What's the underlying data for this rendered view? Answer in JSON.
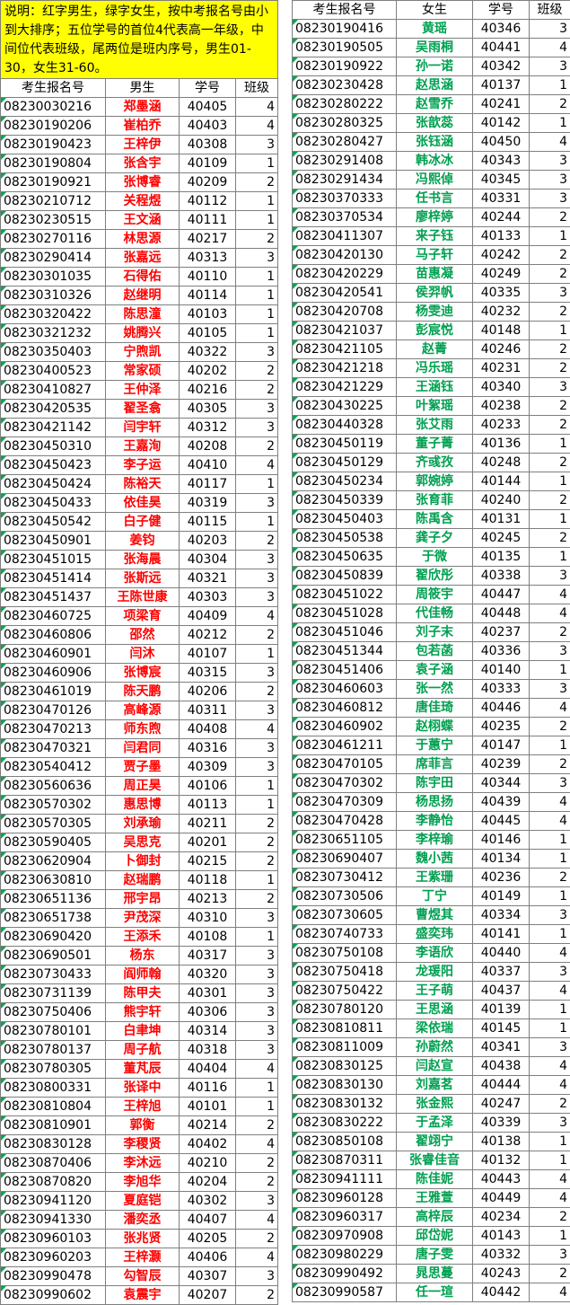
{
  "note": "说明：红字男生，绿字女生，按中考报名号由小到大排序；五位学号的首位4代表高一年级，中间位代表班级，尾两位是班内序号，男生01-30，女生31-60。",
  "colors": {
    "male": "#ff0000",
    "female": "#00a050",
    "note_bg": "#ffff00"
  },
  "male_table": {
    "headers": [
      "考生报名号",
      "男生",
      "学号",
      "班级"
    ],
    "rows": [
      [
        "08230030216",
        "郑墨涵",
        "40405",
        "4"
      ],
      [
        "08230190206",
        "崔柏乔",
        "40403",
        "4"
      ],
      [
        "08230190423",
        "王梓伊",
        "40308",
        "3"
      ],
      [
        "08230190804",
        "张含宇",
        "40109",
        "1"
      ],
      [
        "08230190921",
        "张博睿",
        "40209",
        "2"
      ],
      [
        "08230210712",
        "关程煜",
        "40112",
        "1"
      ],
      [
        "08230230515",
        "王文涵",
        "40111",
        "1"
      ],
      [
        "08230270116",
        "林思源",
        "40217",
        "2"
      ],
      [
        "08230290414",
        "张嘉远",
        "40313",
        "3"
      ],
      [
        "08230301035",
        "石得佑",
        "40110",
        "1"
      ],
      [
        "08230310326",
        "赵继明",
        "40114",
        "1"
      ],
      [
        "08230320422",
        "陈思潼",
        "40103",
        "1"
      ],
      [
        "08230321232",
        "姚腾兴",
        "40105",
        "1"
      ],
      [
        "08230350403",
        "宁煦凯",
        "40322",
        "3"
      ],
      [
        "08230400523",
        "常家硕",
        "40202",
        "2"
      ],
      [
        "08230410827",
        "王仲泽",
        "40216",
        "2"
      ],
      [
        "08230420535",
        "翟圣翕",
        "40305",
        "3"
      ],
      [
        "08230421142",
        "闫宇轩",
        "40312",
        "3"
      ],
      [
        "08230450310",
        "王嘉洵",
        "40208",
        "2"
      ],
      [
        "08230450423",
        "李子运",
        "40410",
        "4"
      ],
      [
        "08230450424",
        "陈裕天",
        "40117",
        "1"
      ],
      [
        "08230450433",
        "依佳昊",
        "40319",
        "3"
      ],
      [
        "08230450542",
        "白子健",
        "40115",
        "1"
      ],
      [
        "08230450901",
        "姜钧",
        "40203",
        "2"
      ],
      [
        "08230451015",
        "张海晨",
        "40304",
        "3"
      ],
      [
        "08230451414",
        "张斯远",
        "40321",
        "3"
      ],
      [
        "08230451437",
        "王陈世康",
        "40303",
        "3"
      ],
      [
        "08230460725",
        "项梁育",
        "40409",
        "4"
      ],
      [
        "08230460806",
        "邵然",
        "40212",
        "2"
      ],
      [
        "08230460901",
        "闫沐",
        "40107",
        "1"
      ],
      [
        "08230460906",
        "张博宸",
        "40315",
        "3"
      ],
      [
        "08230461019",
        "陈天鹏",
        "40206",
        "2"
      ],
      [
        "08230470126",
        "高峰源",
        "40311",
        "3"
      ],
      [
        "08230470213",
        "师东煦",
        "40408",
        "4"
      ],
      [
        "08230470321",
        "闫君同",
        "40316",
        "3"
      ],
      [
        "08230540412",
        "贾子墨",
        "40309",
        "3"
      ],
      [
        "08230560636",
        "周正昊",
        "40106",
        "1"
      ],
      [
        "08230570302",
        "惠思博",
        "40113",
        "1"
      ],
      [
        "08230570305",
        "刘承瑜",
        "40211",
        "2"
      ],
      [
        "08230590405",
        "吴思克",
        "40201",
        "2"
      ],
      [
        "08230620904",
        "卜御封",
        "40215",
        "2"
      ],
      [
        "08230630810",
        "赵瑞鹏",
        "40118",
        "1"
      ],
      [
        "08230651136",
        "邢宇昂",
        "40213",
        "2"
      ],
      [
        "08230651738",
        "尹茂深",
        "40310",
        "3"
      ],
      [
        "08230690420",
        "王添禾",
        "40108",
        "1"
      ],
      [
        "08230690501",
        "杨东",
        "40317",
        "3"
      ],
      [
        "08230730433",
        "阎师翰",
        "40320",
        "3"
      ],
      [
        "08230731139",
        "陈甲夫",
        "40301",
        "3"
      ],
      [
        "08230750406",
        "熊宇轩",
        "40306",
        "3"
      ],
      [
        "08230780101",
        "白聿坤",
        "40314",
        "3"
      ],
      [
        "08230780137",
        "周子航",
        "40318",
        "3"
      ],
      [
        "08230780305",
        "董芃辰",
        "40404",
        "4"
      ],
      [
        "08230800331",
        "张译中",
        "40116",
        "1"
      ],
      [
        "08230810804",
        "王梓旭",
        "40101",
        "1"
      ],
      [
        "08230810901",
        "郭衡",
        "40214",
        "2"
      ],
      [
        "08230830128",
        "李稷贤",
        "40402",
        "4"
      ],
      [
        "08230870406",
        "李沐远",
        "40210",
        "2"
      ],
      [
        "08230870820",
        "李旭华",
        "40204",
        "2"
      ],
      [
        "08230941120",
        "夏庭铠",
        "40302",
        "3"
      ],
      [
        "08230941330",
        "潘奕丞",
        "40407",
        "4"
      ],
      [
        "08230960103",
        "张兆贤",
        "40205",
        "2"
      ],
      [
        "08230960203",
        "王梓灏",
        "40406",
        "4"
      ],
      [
        "08230990478",
        "勾智辰",
        "40307",
        "3"
      ],
      [
        "08230990602",
        "袁震宇",
        "40207",
        "2"
      ]
    ]
  },
  "female_table": {
    "headers": [
      "考生报名号",
      "女生",
      "学号",
      "班级"
    ],
    "rows": [
      [
        "08230190416",
        "黄瑶",
        "40346",
        "3"
      ],
      [
        "08230190505",
        "吴雨桐",
        "40441",
        "4"
      ],
      [
        "08230190922",
        "孙一诺",
        "40342",
        "3"
      ],
      [
        "08230230428",
        "赵思涵",
        "40137",
        "1"
      ],
      [
        "08230280222",
        "赵雪乔",
        "40241",
        "2"
      ],
      [
        "08230280325",
        "张歆蕊",
        "40142",
        "1"
      ],
      [
        "08230280427",
        "张钰涵",
        "40450",
        "4"
      ],
      [
        "08230291408",
        "韩冰冰",
        "40343",
        "3"
      ],
      [
        "08230291434",
        "冯熙倬",
        "40345",
        "3"
      ],
      [
        "08230370333",
        "任书言",
        "40331",
        "3"
      ],
      [
        "08230370534",
        "廖梓婷",
        "40244",
        "2"
      ],
      [
        "08230411307",
        "来子钰",
        "40133",
        "1"
      ],
      [
        "08230420130",
        "马子轩",
        "40242",
        "2"
      ],
      [
        "08230420229",
        "苗惠凝",
        "40249",
        "2"
      ],
      [
        "08230420541",
        "侯羿帆",
        "40335",
        "3"
      ],
      [
        "08230420708",
        "杨雯迪",
        "40232",
        "2"
      ],
      [
        "08230421037",
        "彭宸悦",
        "40148",
        "1"
      ],
      [
        "08230421105",
        "赵菁",
        "40246",
        "2"
      ],
      [
        "08230421218",
        "冯乐瑶",
        "40231",
        "2"
      ],
      [
        "08230421229",
        "王涵钰",
        "40340",
        "3"
      ],
      [
        "08230430225",
        "叶絮瑶",
        "40238",
        "2"
      ],
      [
        "08230440328",
        "张艾雨",
        "40233",
        "2"
      ],
      [
        "08230450119",
        "董子菁",
        "40136",
        "1"
      ],
      [
        "08230450129",
        "齐彧孜",
        "40248",
        "2"
      ],
      [
        "08230450234",
        "郭婉婷",
        "40144",
        "1"
      ],
      [
        "08230450339",
        "张育菲",
        "40240",
        "2"
      ],
      [
        "08230450403",
        "陈禹含",
        "40131",
        "1"
      ],
      [
        "08230450538",
        "龚子夕",
        "40245",
        "2"
      ],
      [
        "08230450635",
        "于微",
        "40135",
        "1"
      ],
      [
        "08230450839",
        "翟欣彤",
        "40338",
        "3"
      ],
      [
        "08230451022",
        "周筱宇",
        "40447",
        "4"
      ],
      [
        "08230451028",
        "代佳畅",
        "40448",
        "4"
      ],
      [
        "08230451046",
        "刘子末",
        "40237",
        "2"
      ],
      [
        "08230451344",
        "包若菡",
        "40336",
        "3"
      ],
      [
        "08230451406",
        "袁子涵",
        "40140",
        "1"
      ],
      [
        "08230460603",
        "张一然",
        "40333",
        "3"
      ],
      [
        "08230460812",
        "唐佳琦",
        "40446",
        "4"
      ],
      [
        "08230460902",
        "赵栩蝶",
        "40235",
        "2"
      ],
      [
        "08230461211",
        "于蕙宁",
        "40147",
        "1"
      ],
      [
        "08230470105",
        "席菲言",
        "40239",
        "2"
      ],
      [
        "08230470302",
        "陈宇田",
        "40344",
        "3"
      ],
      [
        "08230470309",
        "杨思扬",
        "40439",
        "4"
      ],
      [
        "08230470428",
        "李静怡",
        "40445",
        "4"
      ],
      [
        "08230651105",
        "李梓瑜",
        "40146",
        "1"
      ],
      [
        "08230690407",
        "魏小茜",
        "40134",
        "1"
      ],
      [
        "08230730412",
        "王紫珊",
        "40236",
        "2"
      ],
      [
        "08230730506",
        "丁宁",
        "40149",
        "1"
      ],
      [
        "08230730605",
        "曹煜其",
        "40334",
        "3"
      ],
      [
        "08230740733",
        "盛奕玮",
        "40141",
        "1"
      ],
      [
        "08230750108",
        "李语欣",
        "40440",
        "4"
      ],
      [
        "08230750418",
        "龙瑗阳",
        "40337",
        "3"
      ],
      [
        "08230750422",
        "王子萌",
        "40437",
        "4"
      ],
      [
        "08230780120",
        "王思涵",
        "40139",
        "1"
      ],
      [
        "08230810811",
        "梁依瑞",
        "40145",
        "1"
      ],
      [
        "08230811009",
        "孙蔚然",
        "40341",
        "3"
      ],
      [
        "08230830125",
        "闫赵宣",
        "40438",
        "4"
      ],
      [
        "08230830130",
        "刘嘉茗",
        "40444",
        "4"
      ],
      [
        "08230830132",
        "张金熙",
        "40247",
        "2"
      ],
      [
        "08230830222",
        "于孟泽",
        "40339",
        "3"
      ],
      [
        "08230850108",
        "翟翊宁",
        "40138",
        "1"
      ],
      [
        "08230870311",
        "张睿佳音",
        "40132",
        "1"
      ],
      [
        "08230941111",
        "陈佳妮",
        "40443",
        "4"
      ],
      [
        "08230960128",
        "王雅萱",
        "40449",
        "4"
      ],
      [
        "08230960317",
        "高梓辰",
        "40234",
        "2"
      ],
      [
        "08230970908",
        "邱岱妮",
        "40143",
        "1"
      ],
      [
        "08230980229",
        "唐子雯",
        "40332",
        "3"
      ],
      [
        "08230990492",
        "晁思蔓",
        "40243",
        "2"
      ],
      [
        "08230990587",
        "任一瑄",
        "40442",
        "4"
      ]
    ]
  }
}
